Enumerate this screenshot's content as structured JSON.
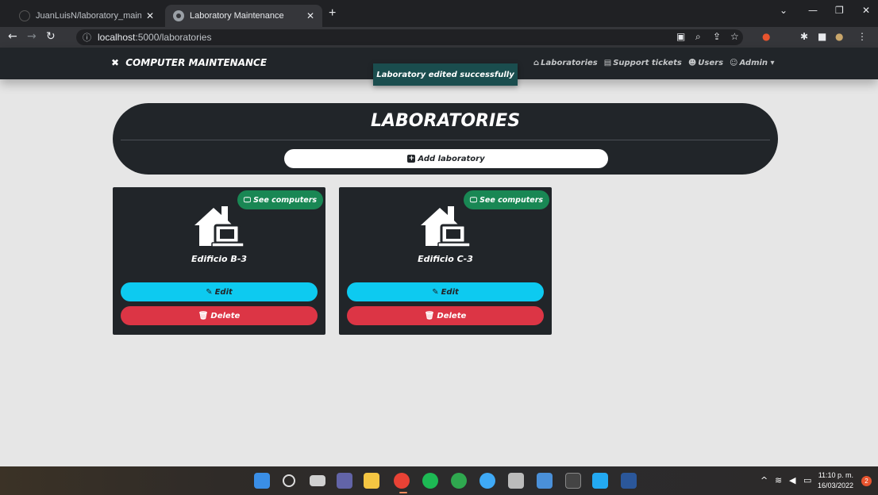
{
  "browser": {
    "tabs": [
      {
        "title": "JuanLuisN/laboratory_maintenan",
        "active": false
      },
      {
        "title": "Laboratory Maintenance",
        "active": true
      }
    ],
    "new_tab_icon": "plus-icon",
    "window_controls": [
      "chevron-down-icon",
      "minimize-icon",
      "restore-icon",
      "close-icon"
    ],
    "address": {
      "host": "localhost",
      "rest": ":5000/laboratories"
    }
  },
  "navbar": {
    "brand": "COMPUTER MAINTENANCE",
    "links": [
      {
        "label": "Laboratories",
        "icon": "laboratory-icon"
      },
      {
        "label": "Support tickets",
        "icon": "ticket-icon"
      },
      {
        "label": "Users",
        "icon": "users-icon"
      },
      {
        "label": "Admin",
        "icon": "user-icon",
        "dropdown": true
      }
    ]
  },
  "toast": {
    "message": "Laboratory edited successfully"
  },
  "page": {
    "title": "LABORATORIES",
    "add_button": "Add laboratory"
  },
  "labs": [
    {
      "name": "Edificio B-3",
      "see_label": "See computers",
      "edit_label": "Edit",
      "delete_label": "Delete"
    },
    {
      "name": "Edificio C-3",
      "see_label": "See computers",
      "edit_label": "Edit",
      "delete_label": "Delete"
    }
  ],
  "taskbar": {
    "clock_time": "11:10 p. m.",
    "clock_date": "16/03/2022",
    "notifications": "2"
  },
  "colors": {
    "dark": "#212529",
    "success": "#198754",
    "info": "#0dcaf0",
    "danger": "#dc3545",
    "toast": "#1a4d4e",
    "background": "#e6e6e6"
  }
}
